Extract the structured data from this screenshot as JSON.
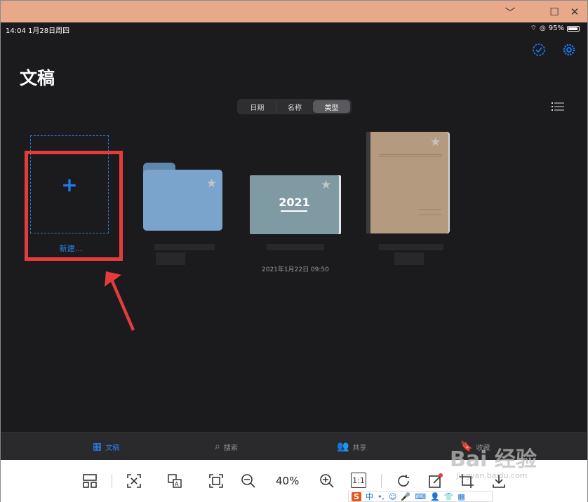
{
  "window": {
    "min_label": "﹀",
    "restore_label": "☐",
    "close_label": "✕",
    "bar_color": "#e8a98a"
  },
  "status": {
    "time": "14:04  1月28日周四",
    "battery": "95%"
  },
  "header": {
    "title": "文稿",
    "select_icon": "checkmark-circle-icon",
    "settings_icon": "gear-icon"
  },
  "sort": {
    "options": [
      "日期",
      "名称",
      "类型"
    ],
    "selected": "类型"
  },
  "documents": {
    "new_label": "新建...",
    "notebook_year": "2021",
    "notebook_date": "2021年1月22日 09:50",
    "accent": "#1f7cf0"
  },
  "tabbar": {
    "items": [
      "文稿",
      "搜索",
      "共享",
      "收藏"
    ]
  },
  "viewer": {
    "zoom": "40%",
    "ratio_label": "1:1"
  },
  "ime": {
    "logo": "S",
    "mode": "中"
  },
  "watermark": {
    "text": "Bai 经验",
    "sub": "jingyan.baidu.com"
  }
}
